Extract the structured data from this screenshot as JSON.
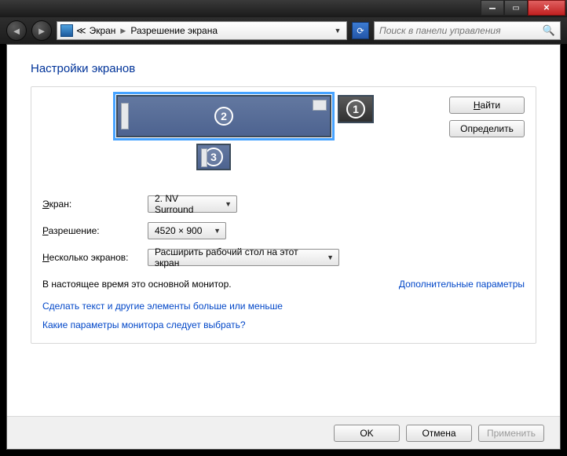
{
  "breadcrumb": {
    "item1": "Экран",
    "item2": "Разрешение экрана"
  },
  "search": {
    "placeholder": "Поиск в панели управления"
  },
  "heading": "Настройки экранов",
  "monitors": {
    "m1": "1",
    "m2": "2",
    "m3": "3"
  },
  "side": {
    "find": "Найти",
    "detect": "Определить"
  },
  "labels": {
    "display": "Экран:",
    "resolution": "Разрешение:",
    "multi": "Несколько экранов:"
  },
  "underline": {
    "display": "Э",
    "resolution": "Р",
    "multi": "Н",
    "find": "Н"
  },
  "combos": {
    "display": "2. NV Surround",
    "resolution": "4520 × 900",
    "multi": "Расширить рабочий стол на этот экран"
  },
  "note": "В настоящее время это основной монитор.",
  "advanced": "Дополнительные параметры",
  "link_text": "Сделать текст и другие элементы больше или меньше",
  "link_help": "Какие параметры монитора следует выбрать?",
  "footer": {
    "ok": "OK",
    "cancel": "Отмена",
    "apply": "Применить"
  }
}
